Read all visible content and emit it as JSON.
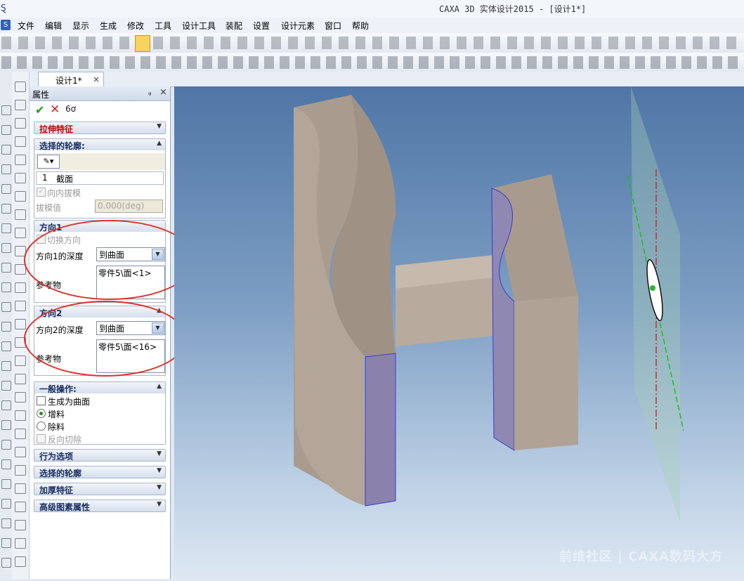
{
  "window": {
    "title": "CAXA 3D 实体设计2015 - [设计1*]"
  },
  "menu": {
    "items": [
      "文件",
      "编辑",
      "显示",
      "生成",
      "修改",
      "工具",
      "设计工具",
      "装配",
      "设置",
      "设计元素",
      "窗口",
      "帮助"
    ]
  },
  "tabs": {
    "doc_tab": "设计1*",
    "close": "×"
  },
  "panel": {
    "title": "属性",
    "pin": "ᵩ",
    "close": "×",
    "ok": "✔",
    "cancel": "✕",
    "preview": "6ơ",
    "feature_header": "拉伸特征",
    "profile_section": {
      "header": "选择的轮廓:",
      "row_index": "1",
      "row_name": "截面"
    },
    "inward_draft": "向内拔模",
    "draft_label": "拔模值",
    "draft_value": "0.000(deg)",
    "dir1": {
      "header": "方向1",
      "switch_dir": "切换方向",
      "depth_label": "方向1的深度",
      "depth_value": "到曲面",
      "ref_label": "参考物",
      "ref_value": "零件5\\面<1>"
    },
    "dir2": {
      "header": "方向2",
      "depth_label": "方向2的深度",
      "depth_value": "到曲面",
      "ref_label": "参考物",
      "ref_value": "零件5\\面<16>"
    },
    "general": {
      "header": "一般操作:",
      "make_surface": "生成为曲面",
      "add": "增料",
      "remove": "除料",
      "reverse_cut": "反向切除"
    },
    "behavior": "行为选项",
    "profile2": "选择的轮廓",
    "thicken": "加厚特征",
    "advanced": "高级图素属性"
  },
  "viewport": {
    "watermark": "前维社区 | CAXA数码大方"
  }
}
